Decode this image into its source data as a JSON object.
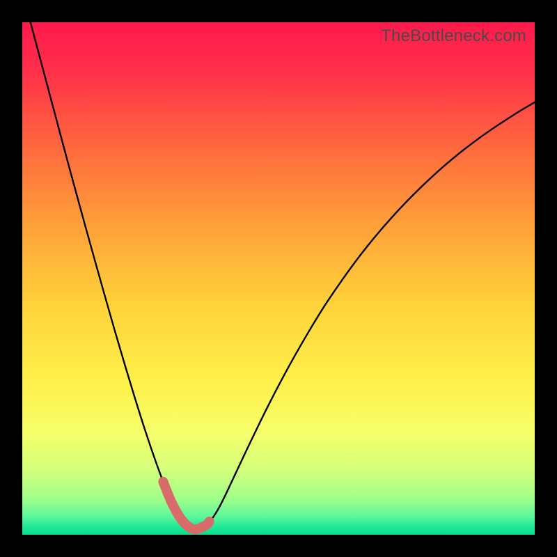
{
  "watermark": "TheBottleneck.com",
  "colors": {
    "frame": "#000000",
    "curve": "#000000",
    "highlight": "#d96b6b",
    "gradient_stops": [
      {
        "offset": 0.0,
        "color": "#ff1a4d"
      },
      {
        "offset": 0.1,
        "color": "#ff314a"
      },
      {
        "offset": 0.25,
        "color": "#ff6b3e"
      },
      {
        "offset": 0.4,
        "color": "#ffa23a"
      },
      {
        "offset": 0.55,
        "color": "#ffd23a"
      },
      {
        "offset": 0.7,
        "color": "#fff04a"
      },
      {
        "offset": 0.8,
        "color": "#f6ff6a"
      },
      {
        "offset": 0.87,
        "color": "#d6ff7a"
      },
      {
        "offset": 0.93,
        "color": "#9fff8a"
      },
      {
        "offset": 0.965,
        "color": "#5cf79a"
      },
      {
        "offset": 0.985,
        "color": "#1ee896"
      },
      {
        "offset": 1.0,
        "color": "#07de8d"
      }
    ]
  },
  "chart_data": {
    "type": "line",
    "title": "",
    "xlabel": "",
    "ylabel": "",
    "xlim": [
      0,
      100
    ],
    "ylim": [
      0,
      100
    ],
    "x": [
      0,
      2,
      4,
      6,
      8,
      10,
      12,
      14,
      16,
      18,
      20,
      22,
      24,
      26,
      28,
      29,
      30,
      31,
      32,
      33,
      34,
      36,
      38,
      40,
      44,
      48,
      52,
      56,
      60,
      66,
      72,
      78,
      84,
      90,
      96,
      100
    ],
    "series": [
      {
        "name": "bottleneck-curve",
        "values": [
          106,
          98.5,
          91,
          83.5,
          76,
          68.6,
          61.3,
          54.1,
          47,
          40,
          33.2,
          26.6,
          20.3,
          14.4,
          9,
          6.6,
          4.6,
          3,
          1.9,
          1.2,
          1,
          1.9,
          4.6,
          8.5,
          17,
          25.2,
          32.8,
          39.8,
          46.2,
          54.6,
          61.8,
          68,
          73.4,
          78,
          82,
          84.4
        ]
      }
    ],
    "highlight_range_x": [
      27.5,
      36.5
    ],
    "minimum_x": 33
  }
}
